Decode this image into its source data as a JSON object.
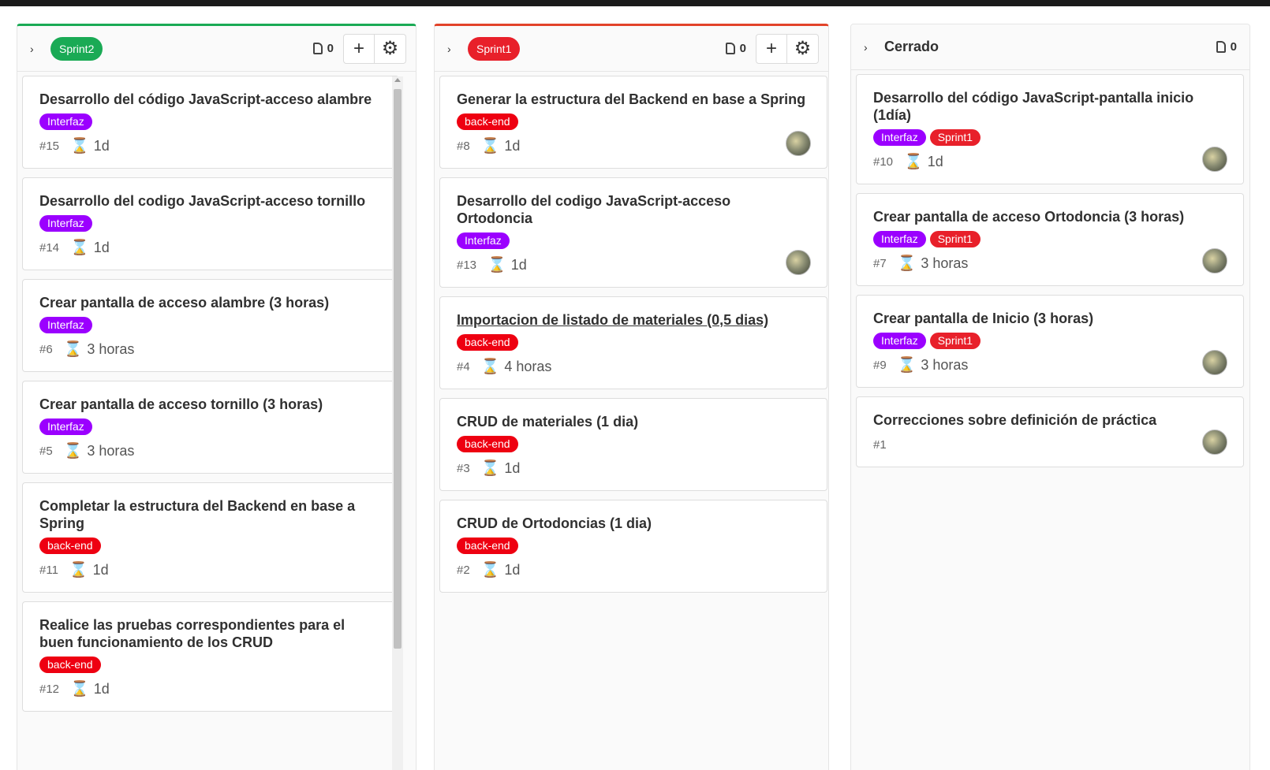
{
  "colors": {
    "sprint2": "#1aaa55",
    "sprint1": "#e8202a",
    "interfaz": "#9b00ff",
    "backend": "#ee0011"
  },
  "columns": [
    {
      "label": "Sprint2",
      "count": "0",
      "cards": [
        {
          "title": "Desarrollo del código JavaScript-acceso alambre",
          "tags": [
            "Interfaz"
          ],
          "iid": "#15",
          "estimate": "1d",
          "avatar": false
        },
        {
          "title": "Desarrollo del codigo JavaScript-acceso tornillo",
          "tags": [
            "Interfaz"
          ],
          "iid": "#14",
          "estimate": "1d",
          "avatar": false
        },
        {
          "title": "Crear pantalla de acceso alambre (3 horas)",
          "tags": [
            "Interfaz"
          ],
          "iid": "#6",
          "estimate": "3 horas",
          "avatar": false
        },
        {
          "title": "Crear pantalla de acceso tornillo (3 horas)",
          "tags": [
            "Interfaz"
          ],
          "iid": "#5",
          "estimate": "3 horas",
          "avatar": false
        },
        {
          "title": "Completar la estructura del Backend en base a Spring",
          "tags": [
            "back-end"
          ],
          "iid": "#11",
          "estimate": "1d",
          "avatar": false
        },
        {
          "title": "Realice las pruebas correspondientes para el buen funcionamiento de los CRUD",
          "tags": [
            "back-end"
          ],
          "iid": "#12",
          "estimate": "1d",
          "avatar": false
        }
      ]
    },
    {
      "label": "Sprint1",
      "count": "0",
      "cards": [
        {
          "title": "Generar la estructura del Backend en base a Spring",
          "tags": [
            "back-end"
          ],
          "iid": "#8",
          "estimate": "1d",
          "avatar": true
        },
        {
          "title": "Desarrollo del codigo JavaScript-acceso Ortodoncia",
          "tags": [
            "Interfaz"
          ],
          "iid": "#13",
          "estimate": "1d",
          "avatar": true
        },
        {
          "title": "Importacion de listado de materiales (0,5 dias)",
          "tags": [
            "back-end"
          ],
          "iid": "#4",
          "estimate": "4 horas",
          "avatar": false,
          "link": true
        },
        {
          "title": "CRUD de materiales (1 dia)",
          "tags": [
            "back-end"
          ],
          "iid": "#3",
          "estimate": "1d",
          "avatar": false
        },
        {
          "title": "CRUD de Ortodoncias (1 dia)",
          "tags": [
            "back-end"
          ],
          "iid": "#2",
          "estimate": "1d",
          "avatar": false
        }
      ]
    },
    {
      "label": "Cerrado",
      "count": "0",
      "cards": [
        {
          "title": "Desarrollo del código JavaScript-pantalla inicio (1día)",
          "tags": [
            "Interfaz",
            "Sprint1"
          ],
          "iid": "#10",
          "estimate": "1d",
          "avatar": true
        },
        {
          "title": "Crear pantalla de acceso Ortodoncia (3 horas)",
          "tags": [
            "Interfaz",
            "Sprint1"
          ],
          "iid": "#7",
          "estimate": "3 horas",
          "avatar": true
        },
        {
          "title": "Crear pantalla de Inicio (3 horas)",
          "tags": [
            "Interfaz",
            "Sprint1"
          ],
          "iid": "#9",
          "estimate": "3 horas",
          "avatar": true
        },
        {
          "title": "Correcciones sobre definición de práctica",
          "tags": [],
          "iid": "#1",
          "estimate": "",
          "avatar": true
        }
      ]
    }
  ]
}
